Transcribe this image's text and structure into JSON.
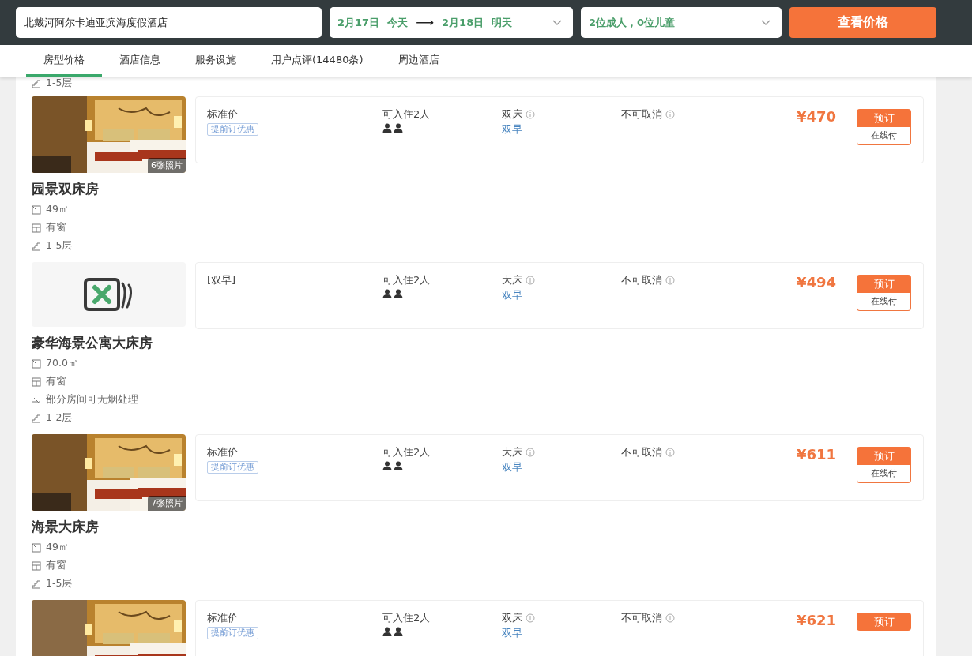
{
  "search_bar": {
    "hotel": "北戴河阿尔卡迪亚滨海度假酒店",
    "dates": {
      "checkin": "2月17日",
      "checkin_note": "今天",
      "arrow": "⟶",
      "checkout": "2月18日",
      "checkout_note": "明天"
    },
    "guests": "2位成人，0位儿童",
    "button": "查看价格"
  },
  "tabs": [
    {
      "label": "房型价格",
      "selected": true
    },
    {
      "label": "酒店信息",
      "selected": false
    },
    {
      "label": "服务设施",
      "selected": false
    },
    {
      "label": "用户点评(14480条)",
      "selected": false
    },
    {
      "label": "周边酒店",
      "selected": false
    }
  ],
  "previous_room_tail": {
    "kind": "floor",
    "text": "1-5层"
  },
  "rooms": [
    {
      "photo": {
        "kind": "picture",
        "count": "6张照片"
      },
      "name": "园景双床房",
      "features": [
        {
          "kind": "area",
          "text": "49㎡"
        },
        {
          "kind": "window",
          "text": "有窗"
        },
        {
          "kind": "floor",
          "text": "1-5层"
        }
      ],
      "rates": [
        {
          "label": "标准价",
          "tag": "提前订优惠",
          "occupancy": "可入住2人",
          "bed": "双床",
          "breakfast": "双早",
          "cancel": "不可取消",
          "price": "¥470",
          "book": "预订",
          "pay": "在线付"
        }
      ]
    },
    {
      "photo": {
        "kind": "no_photo"
      },
      "name": "豪华海景公寓大床房",
      "features": [
        {
          "kind": "area",
          "text": "70.0㎡"
        },
        {
          "kind": "window",
          "text": "有窗"
        },
        {
          "kind": "smoke",
          "text": "部分房间可无烟处理"
        },
        {
          "kind": "floor",
          "text": "1-2层"
        }
      ],
      "rates": [
        {
          "label": "[双早]",
          "occupancy": "可入住2人",
          "bed": "大床",
          "breakfast": "双早",
          "cancel": "不可取消",
          "price": "¥494",
          "book": "预订",
          "pay": "在线付"
        }
      ]
    },
    {
      "photo": {
        "kind": "picture",
        "count": "7张照片"
      },
      "name": "海景大床房",
      "features": [
        {
          "kind": "area",
          "text": "49㎡"
        },
        {
          "kind": "window",
          "text": "有窗"
        },
        {
          "kind": "floor",
          "text": "1-5层"
        }
      ],
      "rates": [
        {
          "label": "标准价",
          "tag": "提前订优惠",
          "occupancy": "可入住2人",
          "bed": "大床",
          "breakfast": "双早",
          "cancel": "不可取消",
          "price": "¥611",
          "book": "预订",
          "pay": "在线付"
        }
      ]
    },
    {
      "rates": [
        {
          "label": "标准价",
          "tag": "提前订优惠",
          "occupancy": "可入住2人",
          "bed": "双床",
          "breakfast": "双早",
          "cancel": "不可取消",
          "price": "¥621",
          "book": "预订"
        }
      ]
    }
  ]
}
